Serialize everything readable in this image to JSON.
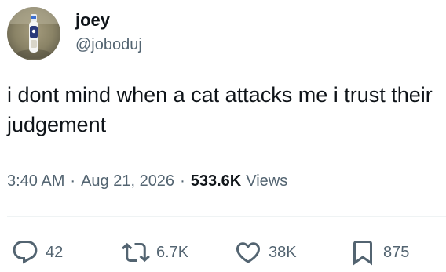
{
  "author": {
    "display_name": "joey",
    "handle": "@joboduj"
  },
  "tweet": {
    "text": "i dont mind when a cat attacks me i trust their judgement",
    "time": "3:40 AM",
    "date": "Aug 21, 2026",
    "views_count": "533.6K",
    "views_label": "Views"
  },
  "actions": {
    "replies": "42",
    "reposts": "6.7K",
    "likes": "38K",
    "bookmarks": "875"
  },
  "colors": {
    "text": "#0f1419",
    "secondary": "#536471",
    "divider": "#eff3f4"
  },
  "icons": [
    "reply-icon",
    "repost-icon",
    "like-icon",
    "bookmark-icon"
  ]
}
